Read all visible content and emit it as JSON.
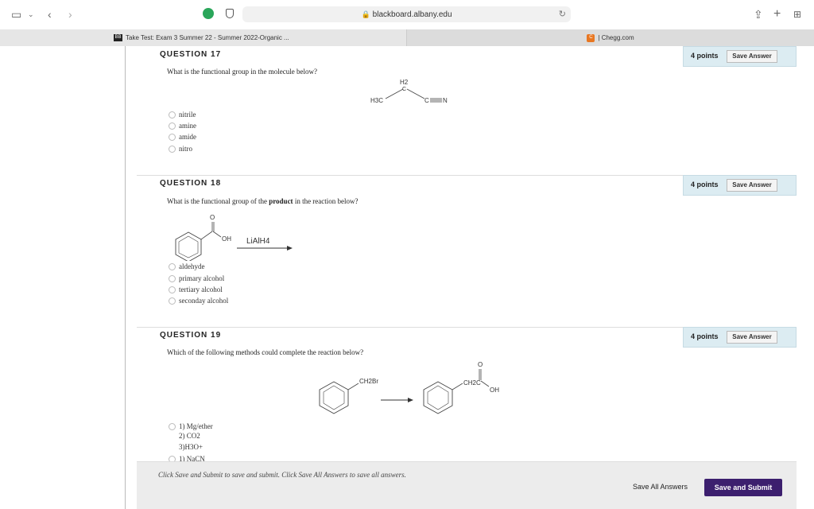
{
  "browser": {
    "url": "blackboard.albany.edu",
    "tabs": [
      {
        "favicon": "BB",
        "label": "Take Test: Exam 3 Summer 22 - Summer 2022-Organic ..."
      },
      {
        "favicon": "C",
        "label": "| Chegg.com"
      }
    ]
  },
  "questions": [
    {
      "heading": "QUESTION 17",
      "points": "4 points",
      "save_label": "Save Answer",
      "prompt": "What is the functional group in the molecule below?",
      "molecule": {
        "h3c": "H3C",
        "h2": "H2",
        "c": "C",
        "cn": "C",
        "n": "N"
      },
      "options": [
        "nitrile",
        "amine",
        "amide",
        "nitro"
      ]
    },
    {
      "heading": "QUESTION 18",
      "points": "4 points",
      "save_label": "Save Answer",
      "prompt_pre": "What is the functional group of the ",
      "prompt_bold": "product",
      "prompt_post": " in the reaction below?",
      "reagent": "LiAlH4",
      "molecule": {
        "o": "O",
        "oh": "OH"
      },
      "options": [
        "aldehyde",
        "primary alcohol",
        "tertiary alcohol",
        "seconday alcohol"
      ]
    },
    {
      "heading": "QUESTION 19",
      "points": "4 points",
      "save_label": "Save Answer",
      "prompt": "Which of the following methods could complete the reaction below?",
      "molecule": {
        "ch2br": "CH2Br",
        "ch2c": "CH2C",
        "o": "O",
        "oh": "OH"
      },
      "option1_lines": [
        "1) Mg/ether",
        "2) CO2",
        "3)H3O+"
      ],
      "option2_lines": [
        "1) NaCN"
      ]
    }
  ],
  "footer": {
    "instructions": "Click Save and Submit to save and submit. Click Save All Answers to save all answers.",
    "save_all": "Save All Answers",
    "submit": "Save and Submit"
  }
}
